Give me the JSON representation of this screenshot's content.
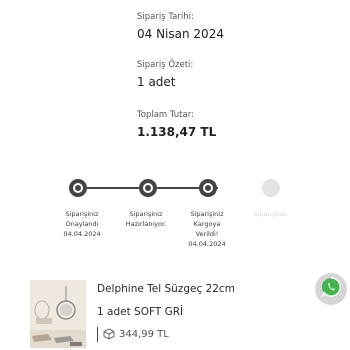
{
  "order": {
    "date_label": "Sipariş Tarihi:",
    "date_value": "04 Nisan 2024",
    "summary_label": "Sipariş Özeti:",
    "summary_value": "1 adet",
    "total_label": "Toplam Tutar:",
    "total_value": "1.138,47 TL"
  },
  "progress": {
    "steps": [
      {
        "line1": "Siparişiniz",
        "line2": "Onaylandı",
        "date": "04.04.2024",
        "active": true
      },
      {
        "line1": "Siparişiniz",
        "line2": "Hazırlanıyor.",
        "date": "",
        "active": true
      },
      {
        "line1": "Siparişiniz",
        "line2": "Kargoya",
        "line3": "Verildi!",
        "date": "04.04.2024",
        "active": true
      },
      {
        "line1": "Siparişiniz",
        "line2": "",
        "date": "",
        "active": false
      }
    ]
  },
  "product": {
    "name": "Delphine Tel Süzgeç 22cm",
    "quantity_variant": "1 adet SOFT GRİ",
    "price": "344,99 TL",
    "box_icon": "package-icon"
  },
  "actions": {
    "whatsapp_icon": "whatsapp-icon"
  },
  "colors": {
    "active_step": "#444444",
    "inactive_step": "#e4e4e4",
    "whatsapp_bg": "#d6d6d6"
  }
}
